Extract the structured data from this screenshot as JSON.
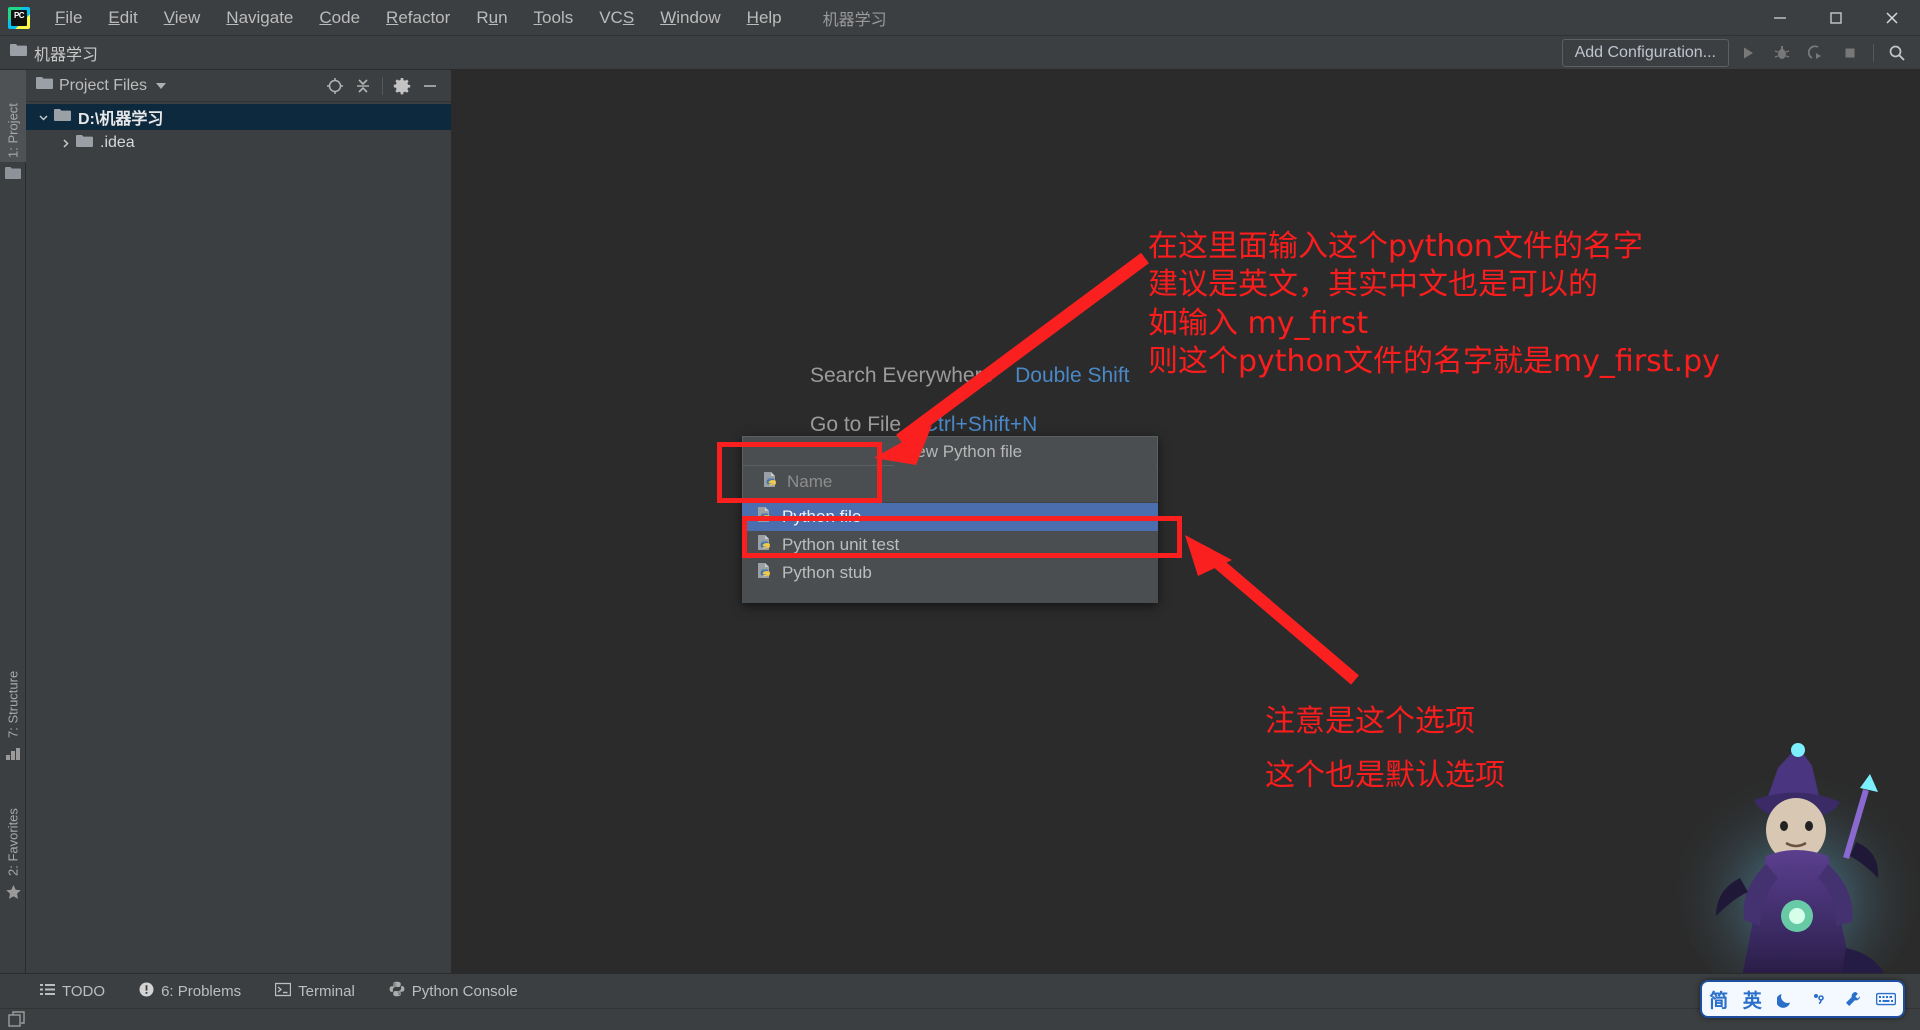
{
  "window": {
    "project_name": "机器学习",
    "minimize": "—",
    "maximize": "▢",
    "close": "✕"
  },
  "menubar": {
    "logo": "pycharm-logo",
    "items": [
      {
        "label": "File",
        "mnemonic": "F"
      },
      {
        "label": "Edit",
        "mnemonic": "E"
      },
      {
        "label": "View",
        "mnemonic": "V"
      },
      {
        "label": "Navigate",
        "mnemonic": "N"
      },
      {
        "label": "Code",
        "mnemonic": "C"
      },
      {
        "label": "Refactor",
        "mnemonic": "R"
      },
      {
        "label": "Run",
        "mnemonic": "u"
      },
      {
        "label": "Tools",
        "mnemonic": "T"
      },
      {
        "label": "VCS",
        "mnemonic": "S"
      },
      {
        "label": "Window",
        "mnemonic": "W"
      },
      {
        "label": "Help",
        "mnemonic": "H"
      }
    ]
  },
  "navbar": {
    "breadcrumb": "机器学习",
    "add_configuration": "Add Configuration...",
    "icons": [
      "run-icon",
      "debug-icon",
      "run-coverage-icon",
      "stop-icon",
      "search-icon"
    ]
  },
  "toolstrip": {
    "project_tab": "1: Project",
    "structure_tab": "7: Structure",
    "favorites_tab": "2: Favorites"
  },
  "project_panel": {
    "title": "Project Files",
    "header_icons": [
      "locate-icon",
      "collapse-all-icon",
      "settings-icon",
      "hide-icon"
    ],
    "tree": [
      {
        "label": "D:\\机器学习",
        "selected": true,
        "expanded": true,
        "depth": 0
      },
      {
        "label": ".idea",
        "selected": false,
        "expanded": false,
        "depth": 1
      }
    ]
  },
  "editor_tips": [
    {
      "action": "Search Everywhere",
      "shortcut": "Double Shift"
    },
    {
      "action": "Go to File",
      "shortcut": "Ctrl+Shift+N"
    }
  ],
  "new_file_popup": {
    "title": "New Python file",
    "name_placeholder": "Name",
    "name_value": "",
    "options": [
      {
        "label": "Python file",
        "selected": true
      },
      {
        "label": "Python unit test",
        "selected": false
      },
      {
        "label": "Python stub",
        "selected": false
      }
    ]
  },
  "annotations": {
    "top": [
      "在这里面输入这个python文件的名字",
      "建议是英文，其实中文也是可以的",
      "如输入  my_first",
      "则这个python文件的名字就是my_first.py"
    ],
    "bottom": [
      "注意是这个选项",
      "这个也是默认选项"
    ],
    "color": "#fb1d1d"
  },
  "statusbar": {
    "items": [
      {
        "label": "TODO",
        "icon": "list-icon"
      },
      {
        "label": "6: Problems",
        "icon": "warning-icon"
      },
      {
        "label": "Terminal",
        "icon": "terminal-icon"
      },
      {
        "label": "Python Console",
        "icon": "python-icon"
      }
    ]
  },
  "ime": {
    "cells": [
      "简",
      "英",
      "moon-icon",
      "punctuation-icon",
      "wrench-icon",
      "keyboard-icon"
    ]
  },
  "colors": {
    "accent_blue": "#4b6eaf",
    "annotation_red": "#fb1d1d",
    "panel_bg": "#3c3f41",
    "editor_bg": "#2b2b2b",
    "tree_selection": "#0d293e"
  }
}
